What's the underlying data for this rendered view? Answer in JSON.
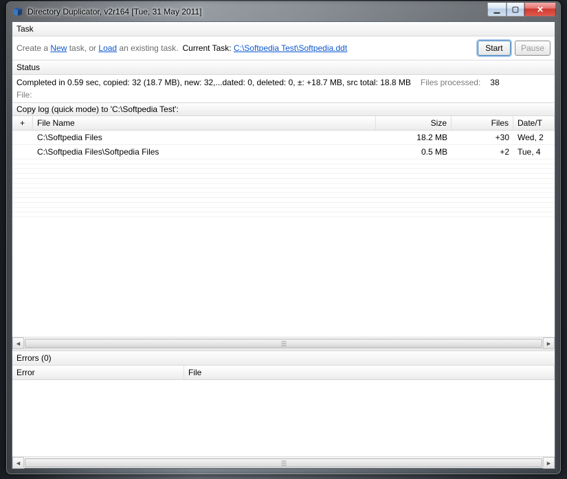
{
  "window": {
    "title": "Directory Duplicator, v2r164 [Tue, 31 May 2011]"
  },
  "task": {
    "header": "Task",
    "prefix": "Create a ",
    "new_link": "New",
    "mid1": " task, or ",
    "load_link": "Load",
    "mid2": " an existing task.",
    "current_label": "Current Task: ",
    "current_path": "C:\\Softpedia Test\\Softpedia.ddt",
    "start_btn": "Start",
    "pause_btn": "Pause"
  },
  "status": {
    "header": "Status",
    "summary": "Completed in 0.59 sec, copied: 32 (18.7 MB), new: 32,...dated: 0, deleted: 0, ±: +18.7 MB, src total: 18.8 MB",
    "files_processed_label": "Files processed:",
    "files_processed": "38",
    "file_label": "File:"
  },
  "log": {
    "title": "Copy log (quick mode) to 'C:\\Softpedia Test':",
    "columns": {
      "plus": "+",
      "name": "File Name",
      "size": "Size",
      "files": "Files",
      "date": "Date/T"
    },
    "rows": [
      {
        "name": "C:\\Softpedia Files",
        "size": "18.2 MB",
        "files": "+30",
        "date": "Wed, 2"
      },
      {
        "name": "C:\\Softpedia Files\\Softpedia Files",
        "size": "0.5 MB",
        "files": "+2",
        "date": "Tue, 4"
      }
    ]
  },
  "errors": {
    "title": "Errors (0)",
    "columns": {
      "error": "Error",
      "file": "File"
    }
  }
}
